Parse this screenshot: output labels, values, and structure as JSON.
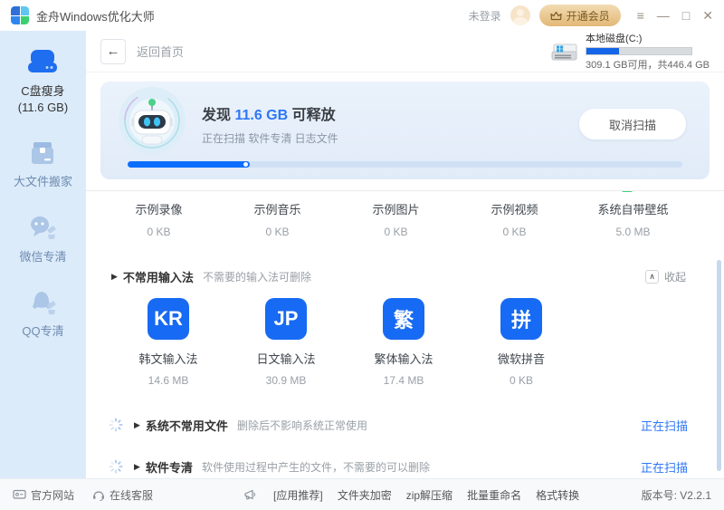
{
  "glyphs": {
    "triangle": "▶",
    "chevron_up": "∧",
    "back_arrow": "←",
    "menu": "≡",
    "minimize": "—",
    "maximize": "□",
    "close": "✕"
  },
  "colors": {
    "accent_blue": "#2e77f6",
    "progress_blue": "#0d6efd",
    "tile_blue": "#176af3",
    "gold_from": "#f2dcb2",
    "gold_to": "#e2b878",
    "gold_text": "#7c5a23",
    "sidebar_bg": "#dcebfa",
    "green_check": "#3dd37d"
  },
  "titlebar": {
    "app_title": "金舟Windows优化大师",
    "login_status": "未登录",
    "vip_label": "开通会员"
  },
  "sidebar": {
    "items": [
      {
        "label": "C盘瘦身",
        "sublabel": "(11.6 GB)"
      },
      {
        "label": "大文件搬家"
      },
      {
        "label": "微信专清"
      },
      {
        "label": "QQ专清"
      }
    ]
  },
  "header": {
    "back_label": "返回首页",
    "disk": {
      "name": "本地磁盘(C:)",
      "usage_text": "309.1 GB可用，共446.4 GB",
      "used_percent": "31",
      "bar_style": "width:31%"
    }
  },
  "scan_banner": {
    "found_prefix": "发现 ",
    "found_size": "11.6 GB",
    "found_suffix": " 可释放",
    "status_text": "正在扫描 软件专清 日志文件",
    "cancel_label": "取消扫描",
    "progress_percent": "22",
    "progress_style": "width:22%"
  },
  "sample_items": [
    {
      "label": "示例录像",
      "size": "0 KB"
    },
    {
      "label": "示例音乐",
      "size": "0 KB"
    },
    {
      "label": "示例图片",
      "size": "0 KB"
    },
    {
      "label": "示例视频",
      "size": "0 KB"
    },
    {
      "label": "系统自带壁纸",
      "size": "5.0 MB"
    }
  ],
  "input_methods": {
    "title": "不常用输入法",
    "subtitle": "不需要的输入法可删除",
    "collapse_label": "收起",
    "items": [
      {
        "badge": "KR",
        "label": "韩文输入法",
        "size": "14.6 MB"
      },
      {
        "badge": "JP",
        "label": "日文输入法",
        "size": "30.9 MB"
      },
      {
        "badge": "繁",
        "label": "繁体输入法",
        "size": "17.4 MB"
      },
      {
        "badge": "拼",
        "label": "微软拼音",
        "size": "0 KB"
      }
    ]
  },
  "scan_sections": [
    {
      "title": "系统不常用文件",
      "subtitle": "删除后不影响系统正常使用",
      "status": "正在扫描"
    },
    {
      "title": "软件专清",
      "subtitle": "软件使用过程中产生的文件，不需要的可以删除",
      "status": "正在扫描"
    }
  ],
  "footer": {
    "links": [
      {
        "label": "官方网站"
      },
      {
        "label": "在线客服"
      }
    ],
    "tools": [
      "[应用推荐]",
      "文件夹加密",
      "zip解压缩",
      "批量重命名",
      "格式转换"
    ],
    "version": "版本号: V2.2.1"
  }
}
